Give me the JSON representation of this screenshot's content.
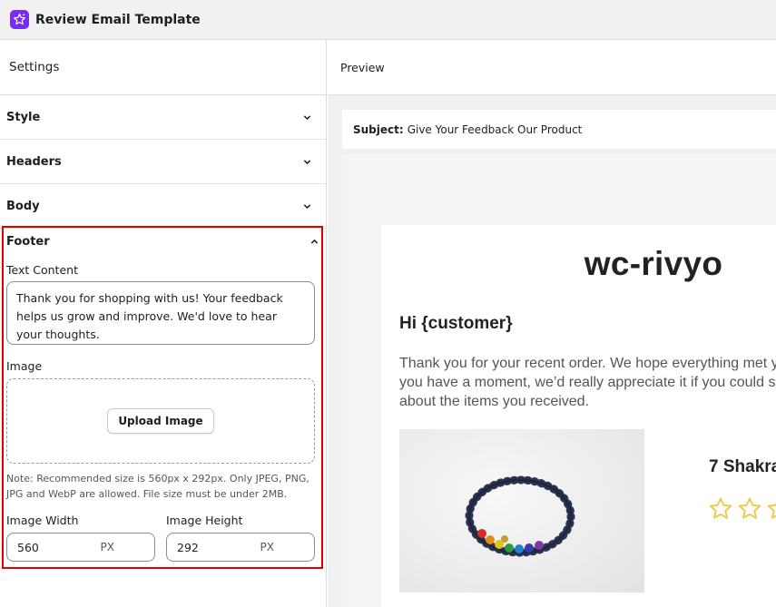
{
  "app": {
    "title": "Review Email Template",
    "icon": "star-sparkle-icon",
    "accent": "#7b2cf3"
  },
  "settings": {
    "title": "Settings",
    "sections": [
      {
        "label": "Style",
        "icon": "chevron-down-icon"
      },
      {
        "label": "Headers",
        "icon": "chevron-down-icon"
      },
      {
        "label": "Body",
        "icon": "chevron-down-icon"
      }
    ],
    "footer": {
      "label": "Footer",
      "icon": "chevron-up-icon",
      "highlight_color": "#e00000",
      "text_content_label": "Text Content",
      "text_content_value": "Thank you for shopping with us! Your feedback helps us grow and improve. We'd love to hear your thoughts.",
      "image_label": "Image",
      "upload_button": "Upload Image",
      "note": "Note: Recommended size is 560px x 292px. Only JPEG, PNG, JPG and WebP are allowed. File size must be under 2MB.",
      "width_label": "Image Width",
      "width_value": "560",
      "height_label": "Image Height",
      "height_value": "292",
      "unit": "PX"
    }
  },
  "preview": {
    "title": "Preview",
    "subject_label": "Subject:",
    "subject_value": "Give Your Feedback Our Product",
    "email": {
      "brand": "wc-rivyo",
      "greeting": "Hi {customer}",
      "body_lines": [
        "Thank you for your recent order. We hope everything met y",
        "you have a moment, we’d really appreciate it if you could s",
        "about the items you received."
      ],
      "product_name": "7 Shakra",
      "rating_icon": "star-outline-icon",
      "star_color": "#f2c94c"
    }
  }
}
